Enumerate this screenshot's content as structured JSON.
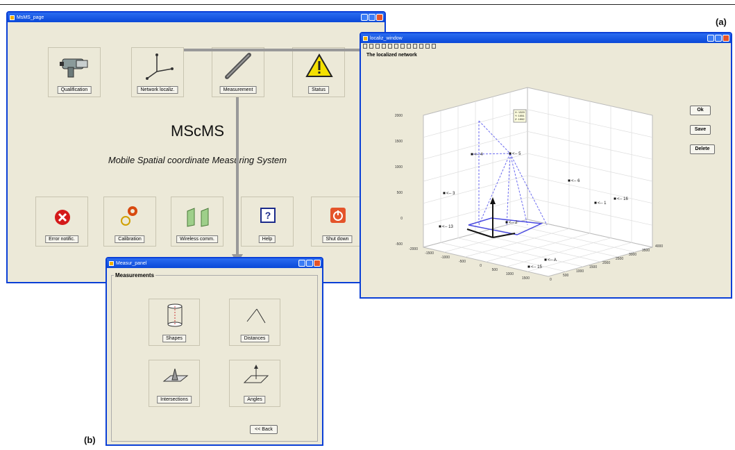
{
  "figure": {
    "label_a": "(a)",
    "label_b": "(b)"
  },
  "main_window": {
    "title": "MsMS_page",
    "app_title": "MScMS",
    "app_subtitle": "Mobile Spatial coordinate Measuring System",
    "top_buttons": [
      "Qualification",
      "Network localiz.",
      "Measurement",
      "Status"
    ],
    "bottom_buttons": [
      "Error notific.",
      "Calibration",
      "Wireless comm.",
      "Help",
      "Shut down"
    ]
  },
  "network_window": {
    "title": "localiz_window",
    "heading": "The localized network",
    "buttons": [
      "Ok",
      "Save",
      "Delete"
    ],
    "tooltip": [
      "X: 1320",
      "Y: 1051",
      "Z: 1992"
    ],
    "nodes": [
      "<-- 4",
      "<-- 5",
      "<-- 3",
      "<-- 13",
      "<-- 2",
      "<-- 6",
      "<-- 1",
      "<-- 16",
      "<-- A",
      "<-- 15"
    ],
    "z_ticks": [
      "2000",
      "1500",
      "1000",
      "500",
      "0",
      "-500"
    ],
    "y_ticks": [
      "-2000",
      "-1500",
      "-1000",
      "-500",
      "0",
      "500",
      "1000",
      "1500"
    ],
    "x_ticks": [
      "0",
      "500",
      "1000",
      "1500",
      "2000",
      "2500",
      "3000",
      "3500",
      "4000"
    ]
  },
  "measure_window": {
    "title": "Measur_panel",
    "group_title": "Measurements",
    "tiles": [
      "Shapes",
      "Distances",
      "Intersections",
      "Angles"
    ],
    "back": "<< Back"
  }
}
